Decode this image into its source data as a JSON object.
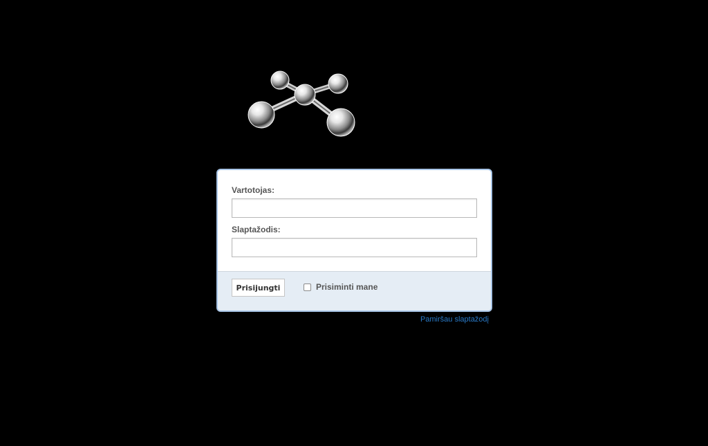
{
  "logo": {
    "icon": "molecule-logo-icon"
  },
  "login_form": {
    "username_label": "Vartotojas:",
    "username_value": "",
    "password_label": "Slaptažodis:",
    "password_value": "",
    "submit_label": "Prisijungti",
    "remember_label": "Prisiminti mane",
    "remember_checked": false
  },
  "forgot_password_link": "Pamiršau slaptažodį",
  "colors": {
    "background": "#000000",
    "box_border": "#a9c6e8",
    "footer_background": "#e5edf5",
    "link": "#2a7ac7",
    "label_text": "#555555"
  }
}
